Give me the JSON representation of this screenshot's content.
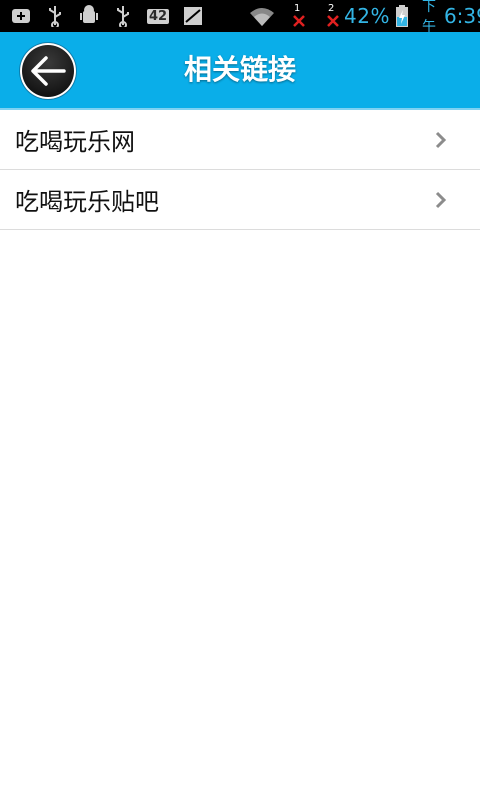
{
  "statusbar": {
    "icons": [
      "plus-box-icon",
      "usb-icon",
      "android-debug-icon",
      "usb-icon",
      "42-badge-icon",
      "screenshot-icon",
      "wifi-icon",
      "sim1-x-icon",
      "sim2-x-icon",
      "battery-charging-icon"
    ],
    "badge_text": "42",
    "sim1_label": "1",
    "sim2_label": "2",
    "battery_percent": "42%",
    "time_prefix": "下午",
    "time": "6:39",
    "accent_color": "#33b5e5"
  },
  "header": {
    "title": "相关链接",
    "background_color": "#0aaee9",
    "back_icon": "arrow-left-icon"
  },
  "list": {
    "items": [
      {
        "label": "吃喝玩乐网"
      },
      {
        "label": "吃喝玩乐贴吧"
      }
    ],
    "chevron_icon": "chevron-right-icon"
  }
}
